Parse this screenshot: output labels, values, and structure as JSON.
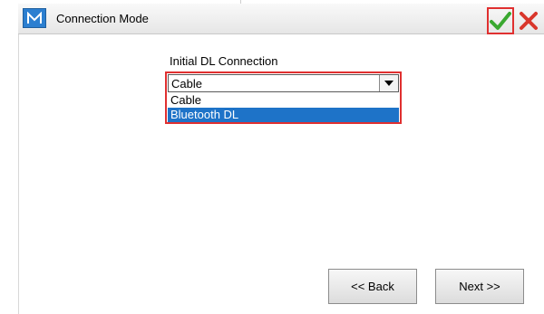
{
  "window": {
    "title": "Connection Mode",
    "logo_icon": "m-logo-icon",
    "ok_icon": "checkmark-icon",
    "cancel_icon": "close-icon"
  },
  "form": {
    "label": "Initial DL Connection",
    "selected_value": "Cable",
    "options": [
      "Cable",
      "Bluetooth DL"
    ],
    "highlighted_option": "Bluetooth DL"
  },
  "buttons": {
    "back": "<< Back",
    "next": "Next >>"
  },
  "colors": {
    "highlight": "#1e73c8",
    "outline_red": "#e03030",
    "ok_green": "#3aa830",
    "cancel_red": "#d9362b"
  }
}
